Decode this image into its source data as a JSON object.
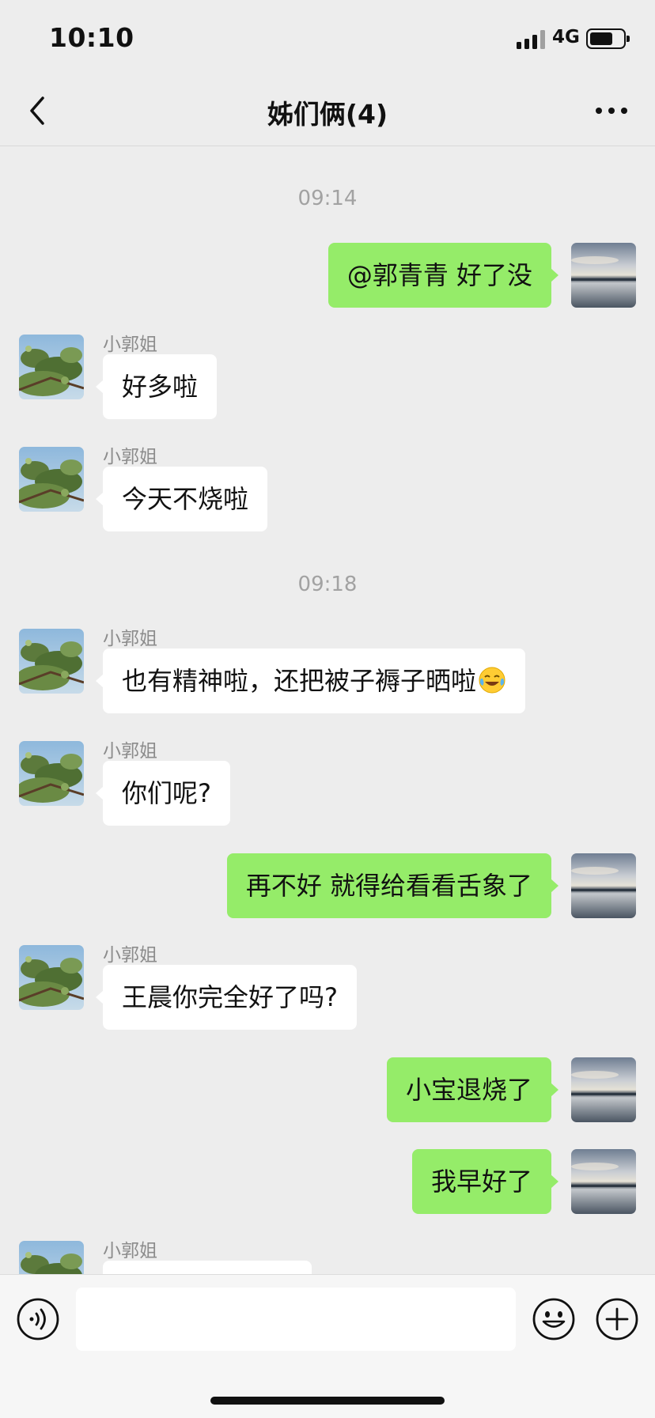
{
  "status_bar": {
    "time": "10:10",
    "network": "4G",
    "battery_level": 0.7
  },
  "nav": {
    "title": "姊们俩(4)",
    "back_icon": "chevron-left-icon",
    "more_icon": "more-dots-icon"
  },
  "messages": {
    "ts1": "09:14",
    "m1": {
      "text": "@郭青青 好了没"
    },
    "m2": {
      "sender": "小郭姐",
      "text": "好多啦"
    },
    "m3": {
      "sender": "小郭姐",
      "text": "今天不烧啦"
    },
    "ts2": "09:18",
    "m4": {
      "sender": "小郭姐",
      "text": "也有精神啦，还把被子褥子晒啦",
      "emoji": "laughing-crying-emoji"
    },
    "m5": {
      "sender": "小郭姐",
      "text": "你们呢?"
    },
    "m6": {
      "text": "再不好  就得给看看舌象了"
    },
    "m7": {
      "sender": "小郭姐",
      "text": "王晨你完全好了吗?"
    },
    "m8": {
      "text": "小宝退烧了"
    },
    "m9": {
      "text": "我早好了"
    },
    "m10": {
      "sender": "小郭姐"
    }
  },
  "input_bar": {
    "value": "",
    "voice_icon": "voice-icon",
    "emoji_icon": "smiley-icon",
    "plus_icon": "plus-icon"
  },
  "colors": {
    "background": "#ededed",
    "outgoing_bubble": "#95ec69",
    "incoming_bubble": "#ffffff"
  }
}
